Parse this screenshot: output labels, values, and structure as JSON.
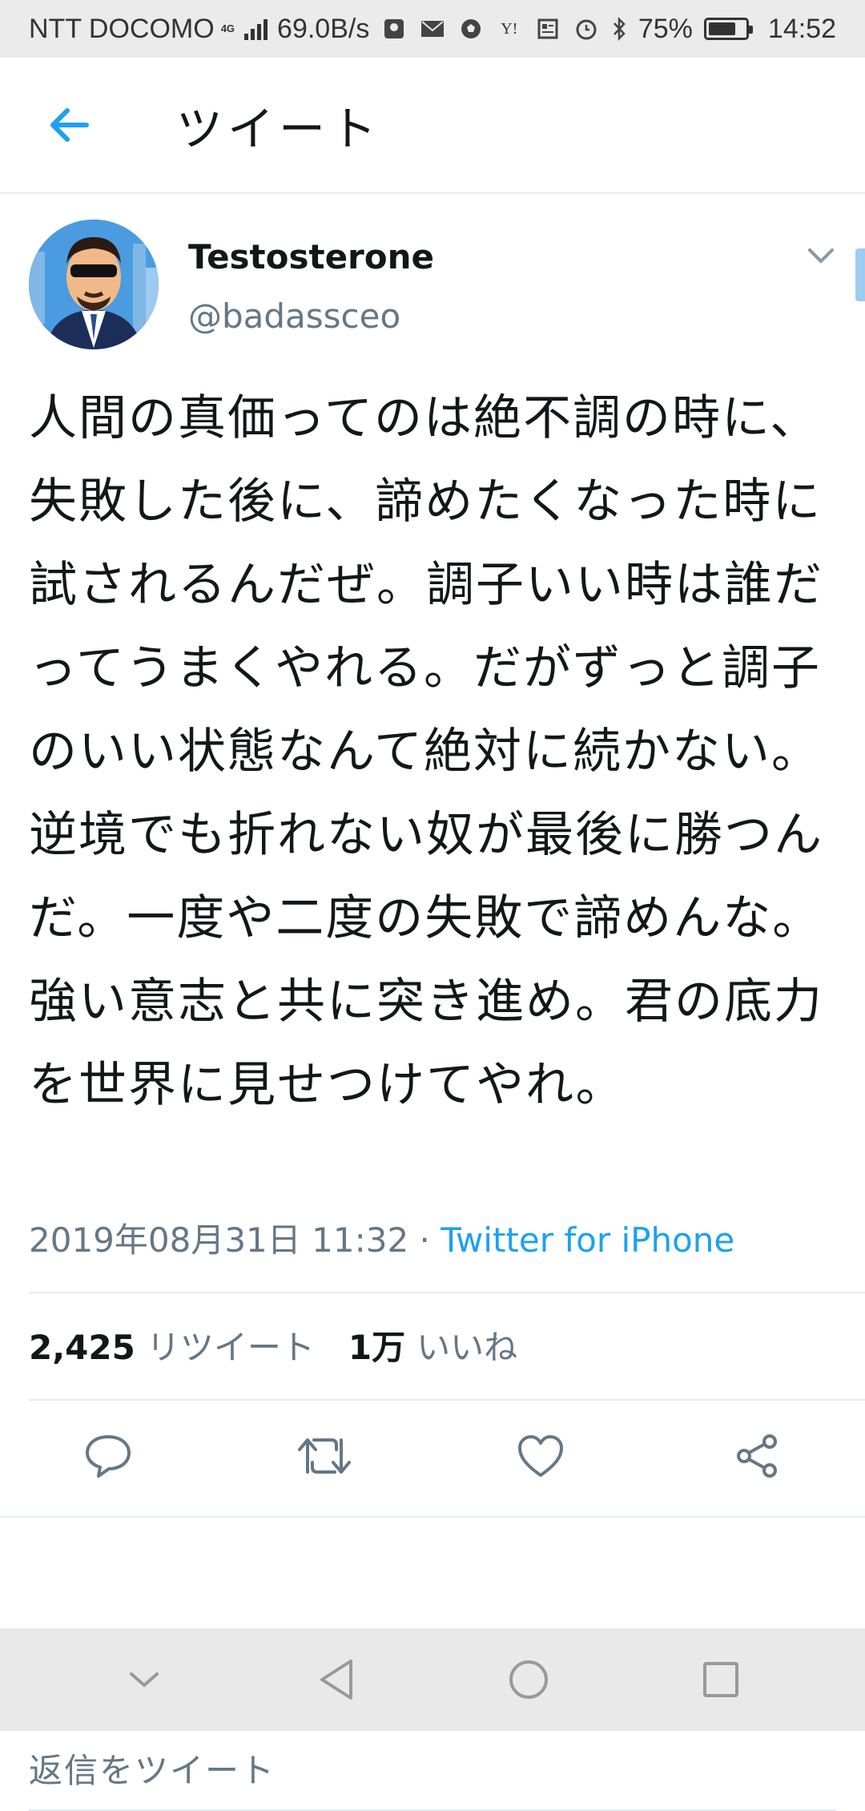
{
  "status_bar": {
    "carrier": "NTT DOCOMO",
    "network": "4G",
    "speed": "69.0B/s",
    "icons": [
      "location-icon",
      "mail-icon",
      "soccer-icon",
      "yahoo-icon",
      "news-icon",
      "alarm-icon",
      "bluetooth-icon"
    ],
    "battery_percent": "75%",
    "battery_level": 0.75,
    "time": "14:52"
  },
  "header": {
    "title": "ツイート",
    "back_icon": "arrow-left-icon"
  },
  "tweet": {
    "author_name": "Testosterone",
    "author_handle": "@badassceo",
    "text": "人間の真価ってのは絶不調の時に、失敗した後に、諦めたくなった時に試されるんだぜ。調子いい時は誰だってうまくやれる。だがずっと調子のいい状態なんて絶対に続かない。逆境でも折れない奴が最後に勝つんだ。一度や二度の失敗で諦めんな。強い意志と共に突き進め。君の底力を世界に見せつけてやれ。",
    "timestamp": "2019年08月31日 11:32",
    "separator": " · ",
    "source": "Twitter for iPhone",
    "retweet_count": "2,425",
    "retweet_label": "リツイート",
    "like_count": "1万",
    "like_label": "いいね"
  },
  "actions": [
    "reply-icon",
    "retweet-icon",
    "like-icon",
    "share-icon"
  ],
  "reply_placeholder": "返信をツイート",
  "nav_bar": [
    "hide-nav-icon",
    "back-nav-icon",
    "home-nav-icon",
    "recents-nav-icon"
  ],
  "colors": {
    "accent": "#1da1f2",
    "secondary_text": "#657786",
    "divider": "#e6ecf0"
  }
}
